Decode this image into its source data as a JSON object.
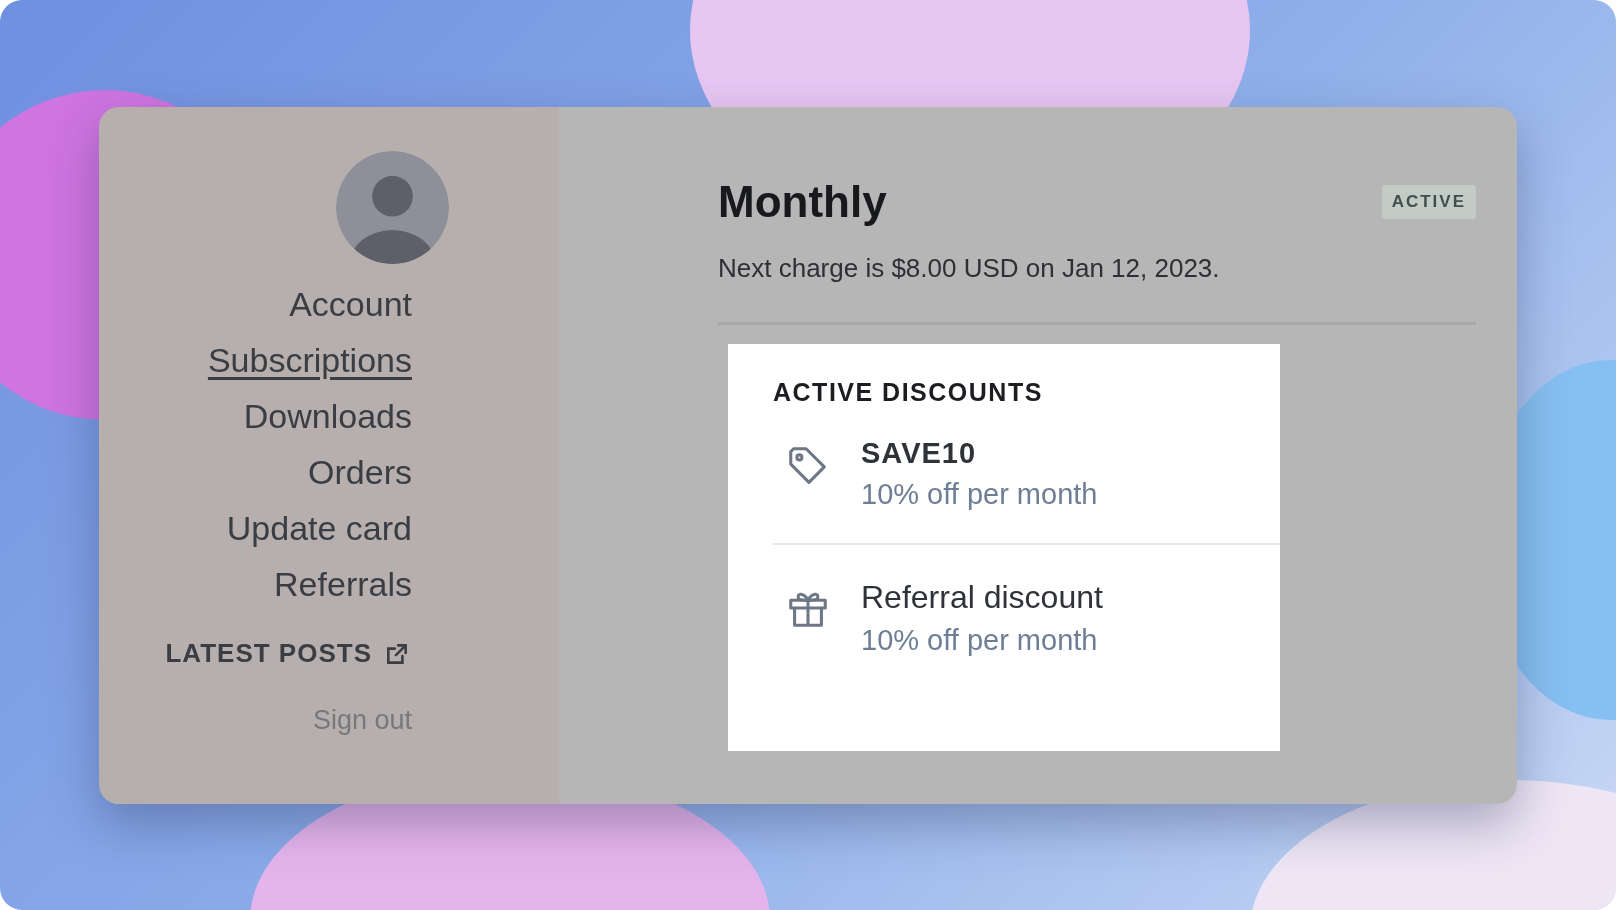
{
  "sidebar": {
    "nav": [
      {
        "label": "Account",
        "selected": false
      },
      {
        "label": "Subscriptions",
        "selected": true
      },
      {
        "label": "Downloads",
        "selected": false
      },
      {
        "label": "Orders",
        "selected": false
      },
      {
        "label": "Update card",
        "selected": false
      },
      {
        "label": "Referrals",
        "selected": false
      }
    ],
    "latest_posts": "LATEST POSTS",
    "sign_out": "Sign out"
  },
  "plan": {
    "title": "Monthly",
    "badge": "ACTIVE",
    "next_charge": "Next charge is $8.00 USD on Jan 12, 2023."
  },
  "discounts": {
    "heading": "ACTIVE DISCOUNTS",
    "items": [
      {
        "kind": "coupon",
        "name": "SAVE10",
        "detail": "10% off per month"
      },
      {
        "kind": "referral",
        "name": "Referral discount",
        "detail": "10% off per month"
      }
    ]
  }
}
